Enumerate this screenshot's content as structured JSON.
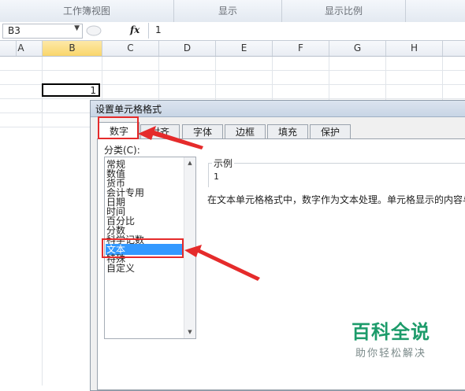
{
  "ribbon": {
    "groups": [
      {
        "label": "工作簿视图"
      },
      {
        "label": "显示"
      },
      {
        "label": "显示比例"
      }
    ]
  },
  "formula_bar": {
    "name_box": "B3",
    "fx_label": "fx",
    "formula": "1"
  },
  "columns": [
    "A",
    "B",
    "C",
    "D",
    "E",
    "F",
    "G",
    "H"
  ],
  "selected_column": "B",
  "active_cell": {
    "ref": "B3",
    "value": "1"
  },
  "dialog": {
    "title": "设置单元格格式",
    "tabs": [
      {
        "label": "数字",
        "active": true
      },
      {
        "label": "对齐",
        "active": false
      },
      {
        "label": "字体",
        "active": false
      },
      {
        "label": "边框",
        "active": false
      },
      {
        "label": "填充",
        "active": false
      },
      {
        "label": "保护",
        "active": false
      }
    ],
    "category_label": "分类(C):",
    "categories": [
      {
        "label": "常规"
      },
      {
        "label": "数值"
      },
      {
        "label": "货币"
      },
      {
        "label": "会计专用"
      },
      {
        "label": "日期"
      },
      {
        "label": "时间"
      },
      {
        "label": "百分比"
      },
      {
        "label": "分数"
      },
      {
        "label": "科学记数"
      },
      {
        "label": "文本",
        "selected": true
      },
      {
        "label": "特殊"
      },
      {
        "label": "自定义"
      }
    ],
    "sample_legend": "示例",
    "sample_value": "1",
    "description": "在文本单元格格式中，数字作为文本处理。单元格显示的内容与"
  },
  "watermark": {
    "title": "百科全说",
    "subtitle": "助你轻松解决"
  },
  "colors": {
    "annotation_red": "#e52b2b",
    "selection_blue": "#3399ff",
    "watermark_green": "#1c9b6a"
  }
}
